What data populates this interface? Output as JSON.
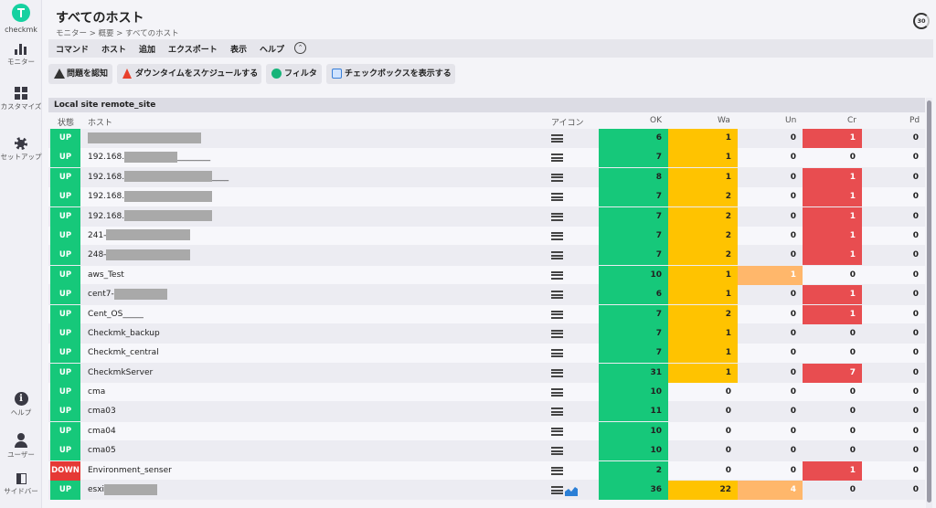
{
  "app": {
    "logo_text": "checkmk"
  },
  "sidebar": {
    "items": [
      {
        "label": "モニター",
        "icon": "monitor-icon"
      },
      {
        "label": "カスタマイズ",
        "icon": "customize-grid-icon"
      },
      {
        "label": "セットアップ",
        "icon": "gear-icon"
      },
      {
        "label": "ヘルプ",
        "icon": "info-icon"
      },
      {
        "label": "ユーザー",
        "icon": "user-icon"
      },
      {
        "label": "サイドバー",
        "icon": "sidebar-icon"
      }
    ]
  },
  "header": {
    "title": "すべてのホスト",
    "breadcrumb": "モニター > 概要 > すべてのホスト",
    "refresh_label": "30"
  },
  "menubar": {
    "items": [
      "コマンド",
      "ホスト",
      "追加",
      "エクスポート",
      "表示",
      "ヘルプ"
    ]
  },
  "toolbar": {
    "ack": "問題を認知",
    "downtime": "ダウンタイムをスケジュールする",
    "filter": "フィルタ",
    "checkbox": "チェックボックスを表示する"
  },
  "table": {
    "site_title": "Local site remote_site",
    "columns": {
      "state": "状態",
      "host": "ホスト",
      "icons": "アイコン",
      "ok": "OK",
      "wa": "Wa",
      "un": "Un",
      "cr": "Cr",
      "pd": "Pd"
    },
    "rows": [
      {
        "state": "UP",
        "host": "",
        "redact": 124,
        "ok": "6",
        "wa": "1",
        "un": "0",
        "cr": "1",
        "pd": "0"
      },
      {
        "state": "UP",
        "host": "192.168.",
        "redact": 58,
        "suffix": "________",
        "ok": "7",
        "wa": "1",
        "un": "0",
        "cr": "0",
        "pd": "0"
      },
      {
        "state": "UP",
        "host": "192.168.",
        "redact": 96,
        "suffix": "____",
        "ok": "8",
        "wa": "1",
        "un": "0",
        "cr": "1",
        "pd": "0"
      },
      {
        "state": "UP",
        "host": "192.168.",
        "redact": 96,
        "ok": "7",
        "wa": "2",
        "un": "0",
        "cr": "1",
        "pd": "0"
      },
      {
        "state": "UP",
        "host": "192.168.",
        "redact": 96,
        "ok": "7",
        "wa": "2",
        "un": "0",
        "cr": "1",
        "pd": "0"
      },
      {
        "state": "UP",
        "host": "241-",
        "redact": 92,
        "ok": "7",
        "wa": "2",
        "un": "0",
        "cr": "1",
        "pd": "0"
      },
      {
        "state": "UP",
        "host": "248-",
        "redact": 92,
        "ok": "7",
        "wa": "2",
        "un": "0",
        "cr": "1",
        "pd": "0"
      },
      {
        "state": "UP",
        "host": "aws_Test",
        "ok": "10",
        "wa": "1",
        "un": "1",
        "cr": "0",
        "pd": "0"
      },
      {
        "state": "UP",
        "host": "cent7-",
        "redact": 58,
        "ok": "6",
        "wa": "1",
        "un": "0",
        "cr": "1",
        "pd": "0"
      },
      {
        "state": "UP",
        "host": "Cent_OS_____",
        "ok": "7",
        "wa": "2",
        "un": "0",
        "cr": "1",
        "pd": "0"
      },
      {
        "state": "UP",
        "host": "Checkmk_backup",
        "ok": "7",
        "wa": "1",
        "un": "0",
        "cr": "0",
        "pd": "0"
      },
      {
        "state": "UP",
        "host": "Checkmk_central",
        "ok": "7",
        "wa": "1",
        "un": "0",
        "cr": "0",
        "pd": "0"
      },
      {
        "state": "UP",
        "host": "CheckmkServer",
        "ok": "31",
        "wa": "1",
        "un": "0",
        "cr": "7",
        "pd": "0"
      },
      {
        "state": "UP",
        "host": "cma",
        "ok": "10",
        "wa": "0",
        "un": "0",
        "cr": "0",
        "pd": "0"
      },
      {
        "state": "UP",
        "host": "cma03",
        "ok": "11",
        "wa": "0",
        "un": "0",
        "cr": "0",
        "pd": "0"
      },
      {
        "state": "UP",
        "host": "cma04",
        "ok": "10",
        "wa": "0",
        "un": "0",
        "cr": "0",
        "pd": "0"
      },
      {
        "state": "UP",
        "host": "cma05",
        "ok": "10",
        "wa": "0",
        "un": "0",
        "cr": "0",
        "pd": "0"
      },
      {
        "state": "DOWN",
        "host": "Environment_senser",
        "ok": "2",
        "wa": "0",
        "un": "0",
        "cr": "1",
        "pd": "0"
      },
      {
        "state": "UP",
        "host": "esxi",
        "redact": 58,
        "graph": true,
        "ok": "36",
        "wa": "22",
        "un": "4",
        "cr": "0",
        "pd": "0"
      }
    ]
  },
  "colors": {
    "ok": "#16c87a",
    "warn": "#ffc300",
    "unknown": "#ffb76b",
    "crit": "#e84d50",
    "down": "#e53935"
  }
}
